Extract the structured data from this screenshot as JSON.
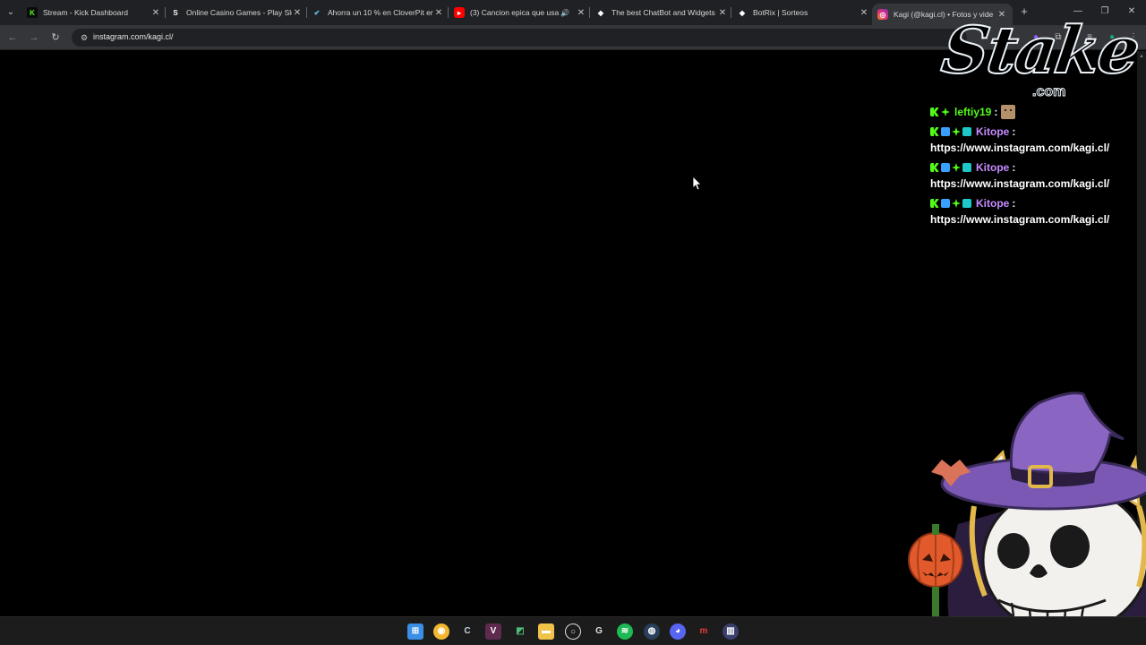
{
  "browser": {
    "tabs": [
      {
        "title": "Stream - Kick Dashboard",
        "favicon": "kick-icon",
        "color": "#53fc18"
      },
      {
        "title": "Online Casino Games - Play Slo",
        "favicon": "stake-icon",
        "color": "#ffffff"
      },
      {
        "title": "Ahorra un 10 % en CloverPit en",
        "favicon": "steam-icon",
        "color": "#66c0f4"
      },
      {
        "title": "(3) Cancion epica que usa T",
        "favicon": "youtube-icon",
        "color": "#ff0000"
      },
      {
        "title": "The best ChatBot and Widgets",
        "favicon": "botrix-icon",
        "color": "#ffffff"
      },
      {
        "title": "BotRix | Sorteos",
        "favicon": "botrix-icon",
        "color": "#ffffff"
      },
      {
        "title": "Kagi (@kagi.cl) • Fotos y vide",
        "favicon": "instagram-icon",
        "color": "#e1306c",
        "active": true
      }
    ],
    "url": "instagram.com/kagi.cl/"
  },
  "overlay": {
    "logo": {
      "word": "Stake",
      "suffix": ".com"
    },
    "chat": [
      {
        "username": "leftiy19",
        "separator": ":",
        "text": "",
        "color": "#53fc18",
        "badges": [
          "kick",
          "star"
        ],
        "emote": true
      },
      {
        "username": "Kitope",
        "separator": ":",
        "text": "https://www.instagram.com/kagi.cl/",
        "color": "#c68bff",
        "badges": [
          "kick",
          "sub",
          "star",
          "grid"
        ]
      },
      {
        "username": "Kitope",
        "separator": ":",
        "text": "https://www.instagram.com/kagi.cl/",
        "color": "#c68bff",
        "badges": [
          "kick",
          "sub",
          "star",
          "grid"
        ]
      },
      {
        "username": "Kitope",
        "separator": ":",
        "text": "https://www.instagram.com/kagi.cl/",
        "color": "#c68bff",
        "badges": [
          "kick",
          "sub",
          "star",
          "grid"
        ]
      }
    ]
  },
  "taskbar": {
    "icons": [
      "windows-start-icon",
      "chrome-icon",
      "ccleaner-icon",
      "editor-icon",
      "app-icon",
      "file-explorer-icon",
      "obs-icon",
      "logitech-icon",
      "spotify-icon",
      "steam-icon",
      "discord-icon",
      "app-m-icon",
      "app-bar-icon"
    ]
  }
}
